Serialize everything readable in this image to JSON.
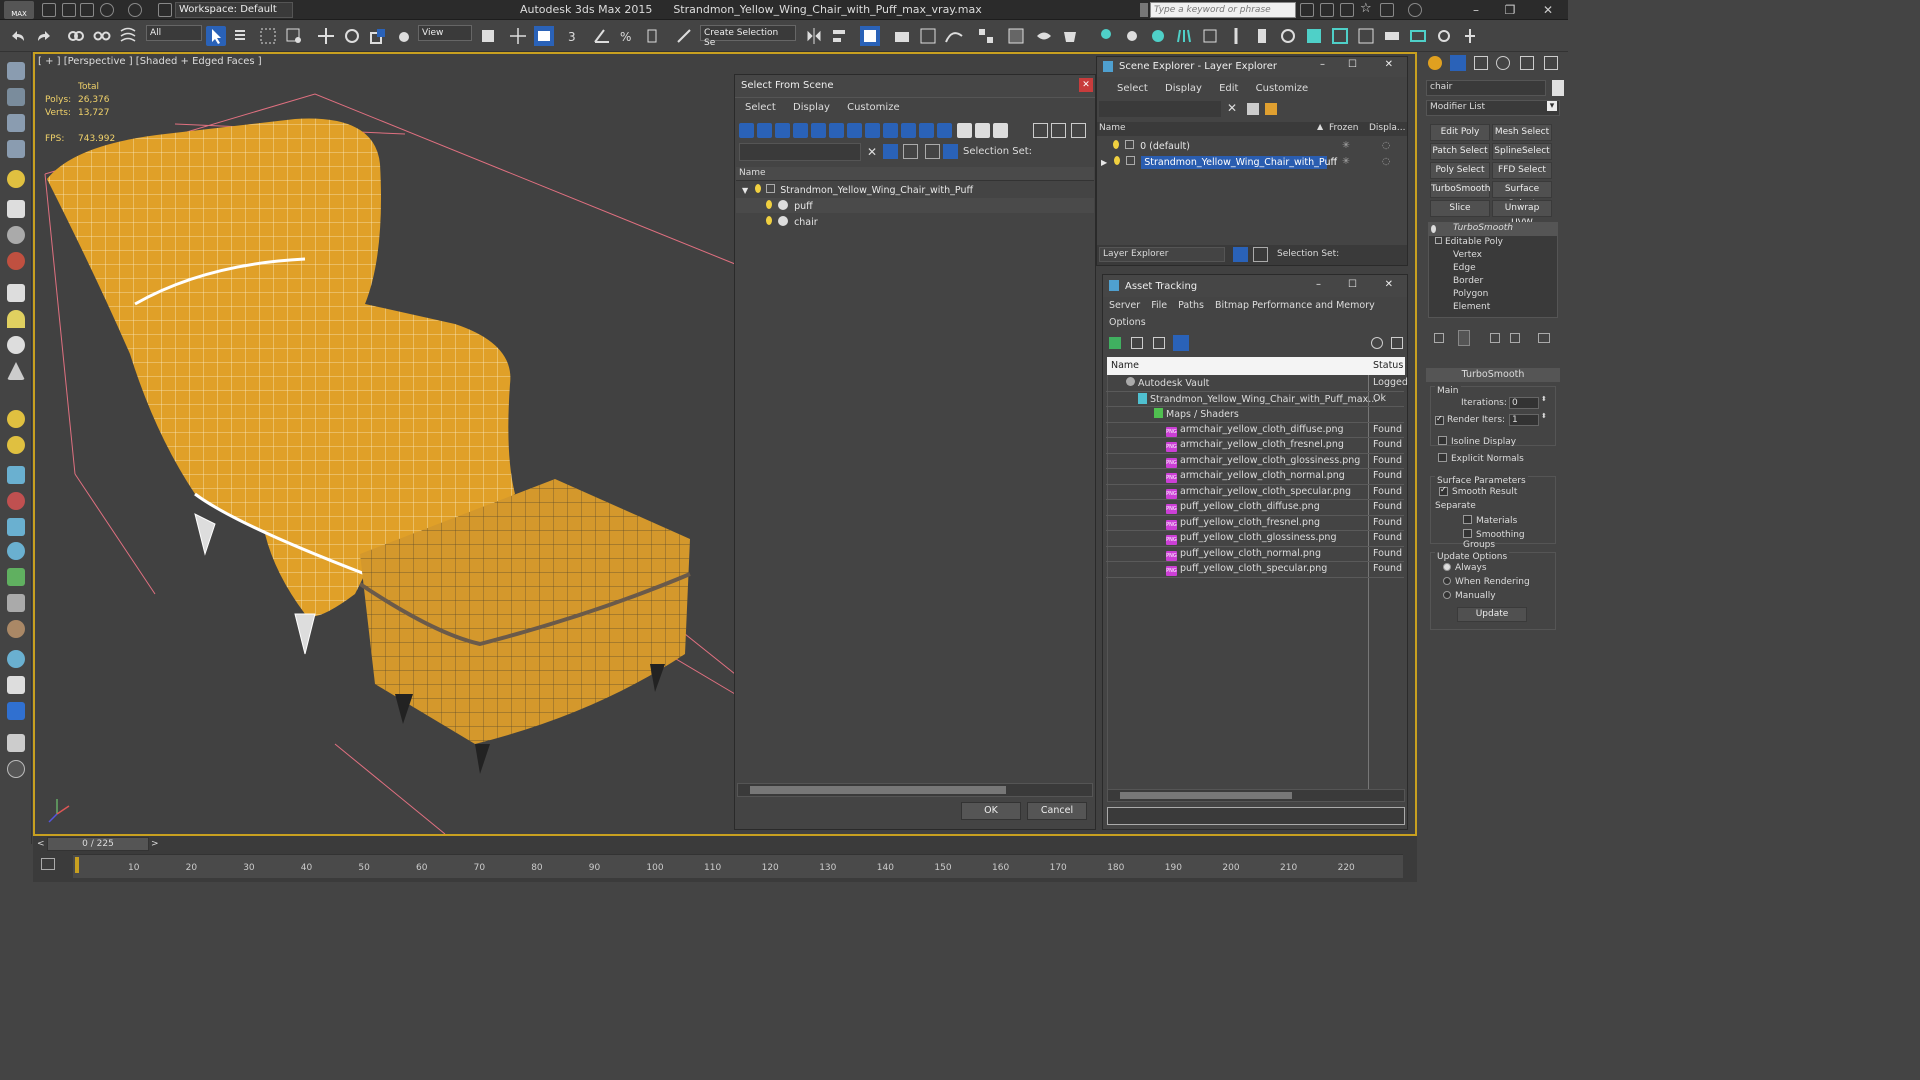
{
  "window": {
    "app_title": "Autodesk 3ds Max  2015",
    "file_title": "Strandmon_Yellow_Wing_Chair_with_Puff_max_vray.max",
    "workspace_label": "Workspace: Default",
    "search_placeholder": "Type a keyword or phrase"
  },
  "toolbar": {
    "selection_filter": "All",
    "ref_coord": "View",
    "create_selection_set": "Create Selection Se"
  },
  "viewport": {
    "label": "[ + ] [Perspective ] [Shaded + Edged Faces ]",
    "stats": {
      "total_label": "Total",
      "polys_label": "Polys:",
      "polys_value": "26,376",
      "verts_label": "Verts:",
      "verts_value": "13,727",
      "fps_label": "FPS:",
      "fps_value": "743.992"
    }
  },
  "select_from_scene": {
    "title": "Select From Scene",
    "menu": [
      "Select",
      "Display",
      "Customize"
    ],
    "selection_set_label": "Selection Set:",
    "column_name": "Name",
    "tree": [
      {
        "label": "Strandmon_Yellow_Wing_Chair_with_Puff"
      },
      {
        "label": "puff"
      },
      {
        "label": "chair"
      }
    ],
    "ok": "OK",
    "cancel": "Cancel"
  },
  "scene_explorer": {
    "title": "Scene Explorer - Layer Explorer",
    "menu": [
      "Select",
      "Display",
      "Edit",
      "Customize"
    ],
    "columns": {
      "name": "Name",
      "frozen": "Frozen",
      "display": "Displa..."
    },
    "rows": [
      {
        "label": "0 (default)"
      },
      {
        "label": "Strandmon_Yellow_Wing_Chair_with_Puff"
      }
    ],
    "footer_dropdown": "Layer Explorer",
    "selection_set_label": "Selection Set:"
  },
  "asset_tracking": {
    "title": "Asset Tracking",
    "menu": [
      "Server",
      "File",
      "Paths",
      "Bitmap Performance and Memory"
    ],
    "menu2": "Options",
    "columns": {
      "name": "Name",
      "status": "Status"
    },
    "rows": [
      {
        "name": "Autodesk Vault",
        "status": "Logged"
      },
      {
        "name": "Strandmon_Yellow_Wing_Chair_with_Puff_max...",
        "status": "Ok"
      },
      {
        "name": "Maps / Shaders",
        "status": ""
      },
      {
        "name": "armchair_yellow_cloth_diffuse.png",
        "status": "Found"
      },
      {
        "name": "armchair_yellow_cloth_fresnel.png",
        "status": "Found"
      },
      {
        "name": "armchair_yellow_cloth_glossiness.png",
        "status": "Found"
      },
      {
        "name": "armchair_yellow_cloth_normal.png",
        "status": "Found"
      },
      {
        "name": "armchair_yellow_cloth_specular.png",
        "status": "Found"
      },
      {
        "name": "puff_yellow_cloth_diffuse.png",
        "status": "Found"
      },
      {
        "name": "puff_yellow_cloth_fresnel.png",
        "status": "Found"
      },
      {
        "name": "puff_yellow_cloth_glossiness.png",
        "status": "Found"
      },
      {
        "name": "puff_yellow_cloth_normal.png",
        "status": "Found"
      },
      {
        "name": "puff_yellow_cloth_specular.png",
        "status": "Found"
      }
    ]
  },
  "command_panel": {
    "object_name": "chair",
    "modifier_list": "Modifier List",
    "buttons": [
      "Edit Poly",
      "Mesh Select",
      "Patch Select",
      "SplineSelect",
      "Poly Select",
      "FFD Select",
      "TurboSmooth",
      "Surface Select",
      "Slice",
      "Unwrap UVW"
    ],
    "stack": [
      "TurboSmooth",
      "Editable Poly",
      "Vertex",
      "Edge",
      "Border",
      "Polygon",
      "Element"
    ],
    "rollout_title": "TurboSmooth",
    "main_label": "Main",
    "iterations_label": "Iterations:",
    "iterations_value": "0",
    "render_iters_label": "Render Iters:",
    "render_iters_value": "1",
    "isoline_label": "Isoline Display",
    "explicit_normals_label": "Explicit Normals",
    "surface_params_label": "Surface Parameters",
    "smooth_result_label": "Smooth Result",
    "separate_label": "Separate",
    "materials_label": "Materials",
    "smoothing_groups_label": "Smoothing Groups",
    "update_options_label": "Update Options",
    "always_label": "Always",
    "when_rendering_label": "When Rendering",
    "manually_label": "Manually",
    "update_button": "Update"
  },
  "timeline": {
    "frame_counter": "0 / 225",
    "ticks": [
      "10",
      "20",
      "30",
      "40",
      "50",
      "60",
      "70",
      "80",
      "90",
      "100",
      "110",
      "120",
      "130",
      "140",
      "150",
      "160",
      "170",
      "180",
      "190",
      "200",
      "210",
      "220"
    ]
  },
  "colors": {
    "viewport_border": "#c8a020",
    "chair_fabric": "#e0a028",
    "selection_highlight": "#2a5db0",
    "asset_png_icon": "#cc3fd6"
  }
}
